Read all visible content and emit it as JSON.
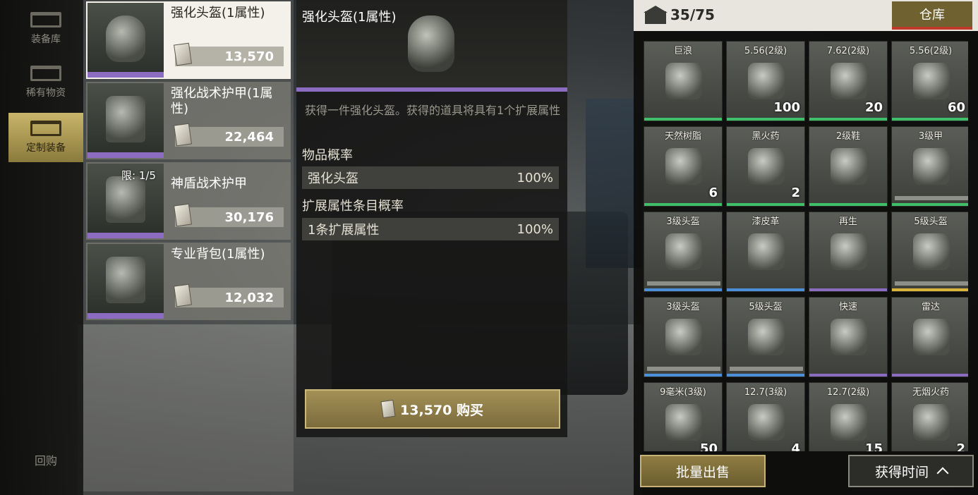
{
  "nav": {
    "items": [
      {
        "label": "装备库",
        "active": false
      },
      {
        "label": "稀有物资",
        "active": false
      },
      {
        "label": "定制装备",
        "active": true
      }
    ],
    "back_label": "回购"
  },
  "shop": {
    "items": [
      {
        "name": "强化头盔(1属性)",
        "price": "13,570",
        "limit": "",
        "icon": "helmet-icon"
      },
      {
        "name": "强化战术护甲(1属性)",
        "price": "22,464",
        "limit": "",
        "icon": "armor-vest-icon"
      },
      {
        "name": "神盾战术护甲",
        "price": "30,176",
        "limit": "限: 1/5",
        "icon": "armor-vest-icon"
      },
      {
        "name": "专业背包(1属性)",
        "price": "12,032",
        "limit": "",
        "icon": "backpack-icon"
      }
    ]
  },
  "detail": {
    "title": "强化头盔(1属性)",
    "description": "获得一件强化头盔。获得的道具将具有1个扩展属性",
    "item_prob_header": "物品概率",
    "item_prob": {
      "name": "强化头盔",
      "value": "100%"
    },
    "ext_prob_header": "扩展属性条目概率",
    "ext_prob": {
      "name": "1条扩展属性",
      "value": "100%"
    },
    "buy_label": "13,570 购买",
    "rarity_color": "#8b6cc0"
  },
  "warehouse": {
    "capacity": "35/75",
    "tab_label": "仓库",
    "items": [
      {
        "label": "巨浪",
        "qty": "",
        "bar": "#3fbf6a",
        "icon": "rifle-icon"
      },
      {
        "label": "5.56(2级)",
        "qty": "100",
        "bar": "#3fbf6a",
        "icon": "ammo-box-icon"
      },
      {
        "label": "7.62(2级)",
        "qty": "20",
        "bar": "#3fbf6a",
        "icon": "ammo-box-icon"
      },
      {
        "label": "5.56(2级)",
        "qty": "60",
        "bar": "#3fbf6a",
        "icon": "ammo-box-icon"
      },
      {
        "label": "天然树脂",
        "qty": "6",
        "bar": "#3fbf6a",
        "icon": "resin-icon"
      },
      {
        "label": "黑火药",
        "qty": "2",
        "bar": "#3fbf6a",
        "icon": "gunpowder-icon"
      },
      {
        "label": "2级鞋",
        "qty": "",
        "bar": "#3fbf6a",
        "icon": "boots-icon"
      },
      {
        "label": "3级甲",
        "qty": "",
        "bar": "#3fbf6a",
        "icon": "armor-vest-icon",
        "durability": true
      },
      {
        "label": "3级头盔",
        "qty": "",
        "bar": "#4a8fd8",
        "icon": "helmet-icon",
        "durability": true
      },
      {
        "label": "漆皮革",
        "qty": "",
        "bar": "#4a8fd8",
        "icon": "leather-icon"
      },
      {
        "label": "再生",
        "qty": "",
        "bar": "#8b6cc0",
        "icon": "injector-icon"
      },
      {
        "label": "5级头盔",
        "qty": "",
        "bar": "#d8b43a",
        "icon": "helmet-icon",
        "durability": true
      },
      {
        "label": "3级头盔",
        "qty": "",
        "bar": "#4a8fd8",
        "icon": "helmet-icon",
        "durability": true
      },
      {
        "label": "5级头盔",
        "qty": "",
        "bar": "#4a8fd8",
        "icon": "helmet-icon",
        "durability": true
      },
      {
        "label": "快速",
        "qty": "",
        "bar": "#8b6cc0",
        "icon": "magazine-icon"
      },
      {
        "label": "雷达",
        "qty": "",
        "bar": "#8b6cc0",
        "icon": "radar-icon"
      },
      {
        "label": "9毫米(3级)",
        "qty": "50",
        "bar": "#4a8fd8",
        "icon": "ammo-box-icon"
      },
      {
        "label": "12.7(3级)",
        "qty": "4",
        "bar": "#4a8fd8",
        "icon": "ammo-can-icon"
      },
      {
        "label": "12.7(2级)",
        "qty": "15",
        "bar": "#3fbf6a",
        "icon": "ammo-can-icon"
      },
      {
        "label": "无烟火药",
        "qty": "2",
        "bar": "#4a8fd8",
        "icon": "gunpowder-icon"
      }
    ],
    "batch_sell_label": "批量出售",
    "sort_label": "获得时间"
  }
}
